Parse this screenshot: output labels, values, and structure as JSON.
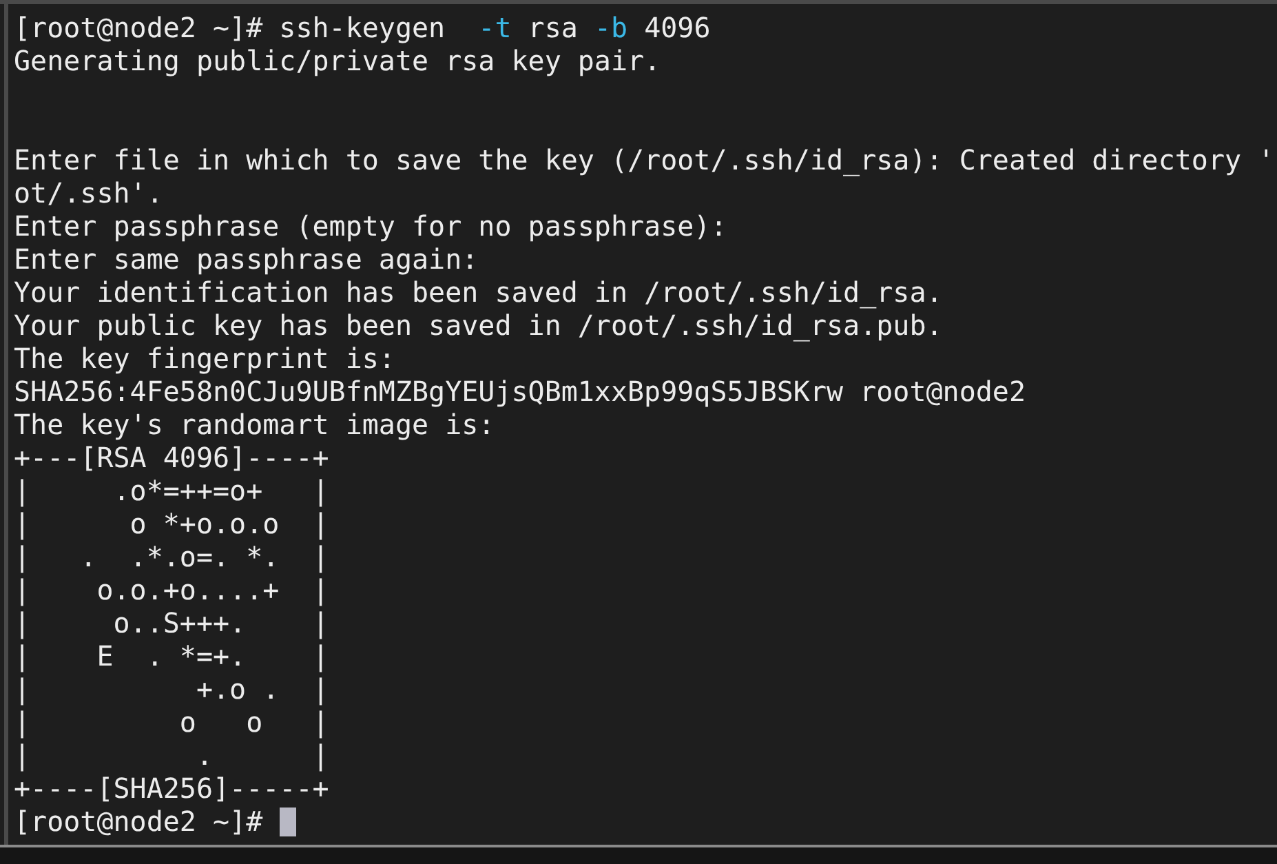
{
  "terminal": {
    "cursor": true,
    "lines": [
      {
        "kind": "text",
        "spans": [
          {
            "kind": "plain",
            "text": "[root@node2 ~]# ssh-keygen  "
          },
          {
            "kind": "option",
            "text": "-t"
          },
          {
            "kind": "plain",
            "text": " rsa "
          },
          {
            "kind": "option",
            "text": "-b"
          },
          {
            "kind": "plain",
            "text": " 4096"
          }
        ]
      },
      {
        "kind": "text",
        "spans": [
          {
            "kind": "plain",
            "text": "Generating public/private rsa key pair."
          }
        ]
      },
      {
        "kind": "blank"
      },
      {
        "kind": "blank"
      },
      {
        "kind": "text",
        "spans": [
          {
            "kind": "plain",
            "text": "Enter file in which to save the key (/root/.ssh/id_rsa): Created directory '"
          }
        ]
      },
      {
        "kind": "text",
        "spans": [
          {
            "kind": "plain",
            "text": "ot/.ssh'."
          }
        ]
      },
      {
        "kind": "text",
        "spans": [
          {
            "kind": "plain",
            "text": "Enter passphrase (empty for no passphrase):"
          }
        ]
      },
      {
        "kind": "text",
        "spans": [
          {
            "kind": "plain",
            "text": "Enter same passphrase again:"
          }
        ]
      },
      {
        "kind": "text",
        "spans": [
          {
            "kind": "plain",
            "text": "Your identification has been saved in /root/.ssh/id_rsa."
          }
        ]
      },
      {
        "kind": "text",
        "spans": [
          {
            "kind": "plain",
            "text": "Your public key has been saved in /root/.ssh/id_rsa.pub."
          }
        ]
      },
      {
        "kind": "text",
        "spans": [
          {
            "kind": "plain",
            "text": "The key fingerprint is:"
          }
        ]
      },
      {
        "kind": "text",
        "spans": [
          {
            "kind": "plain",
            "text": "SHA256:4Fe58n0CJu9UBfnMZBgYEUjsQBm1xxBp99qS5JBSKrw root@node2"
          }
        ]
      },
      {
        "kind": "text",
        "spans": [
          {
            "kind": "plain",
            "text": "The key's randomart image is:"
          }
        ]
      },
      {
        "kind": "text",
        "spans": [
          {
            "kind": "plain",
            "text": "+---[RSA 4096]----+"
          }
        ]
      },
      {
        "kind": "text",
        "spans": [
          {
            "kind": "plain",
            "text": "|     .o*=++=o+   |"
          }
        ]
      },
      {
        "kind": "text",
        "spans": [
          {
            "kind": "plain",
            "text": "|      o *+o.o.o  |"
          }
        ]
      },
      {
        "kind": "text",
        "spans": [
          {
            "kind": "plain",
            "text": "|   .  .*.o=. *.  |"
          }
        ]
      },
      {
        "kind": "text",
        "spans": [
          {
            "kind": "plain",
            "text": "|    o.o.+o....+  |"
          }
        ]
      },
      {
        "kind": "text",
        "spans": [
          {
            "kind": "plain",
            "text": "|     o..S+++.    |"
          }
        ]
      },
      {
        "kind": "text",
        "spans": [
          {
            "kind": "plain",
            "text": "|    E  . *=+.    |"
          }
        ]
      },
      {
        "kind": "text",
        "spans": [
          {
            "kind": "plain",
            "text": "|          +.o .  |"
          }
        ]
      },
      {
        "kind": "text",
        "spans": [
          {
            "kind": "plain",
            "text": "|         o   o   |"
          }
        ]
      },
      {
        "kind": "text",
        "spans": [
          {
            "kind": "plain",
            "text": "|          .      |"
          }
        ]
      },
      {
        "kind": "text",
        "spans": [
          {
            "kind": "plain",
            "text": "+----[SHA256]-----+"
          }
        ]
      },
      {
        "kind": "text",
        "spans": [
          {
            "kind": "plain",
            "text": "[root@node2 ~]# "
          }
        ]
      }
    ]
  }
}
